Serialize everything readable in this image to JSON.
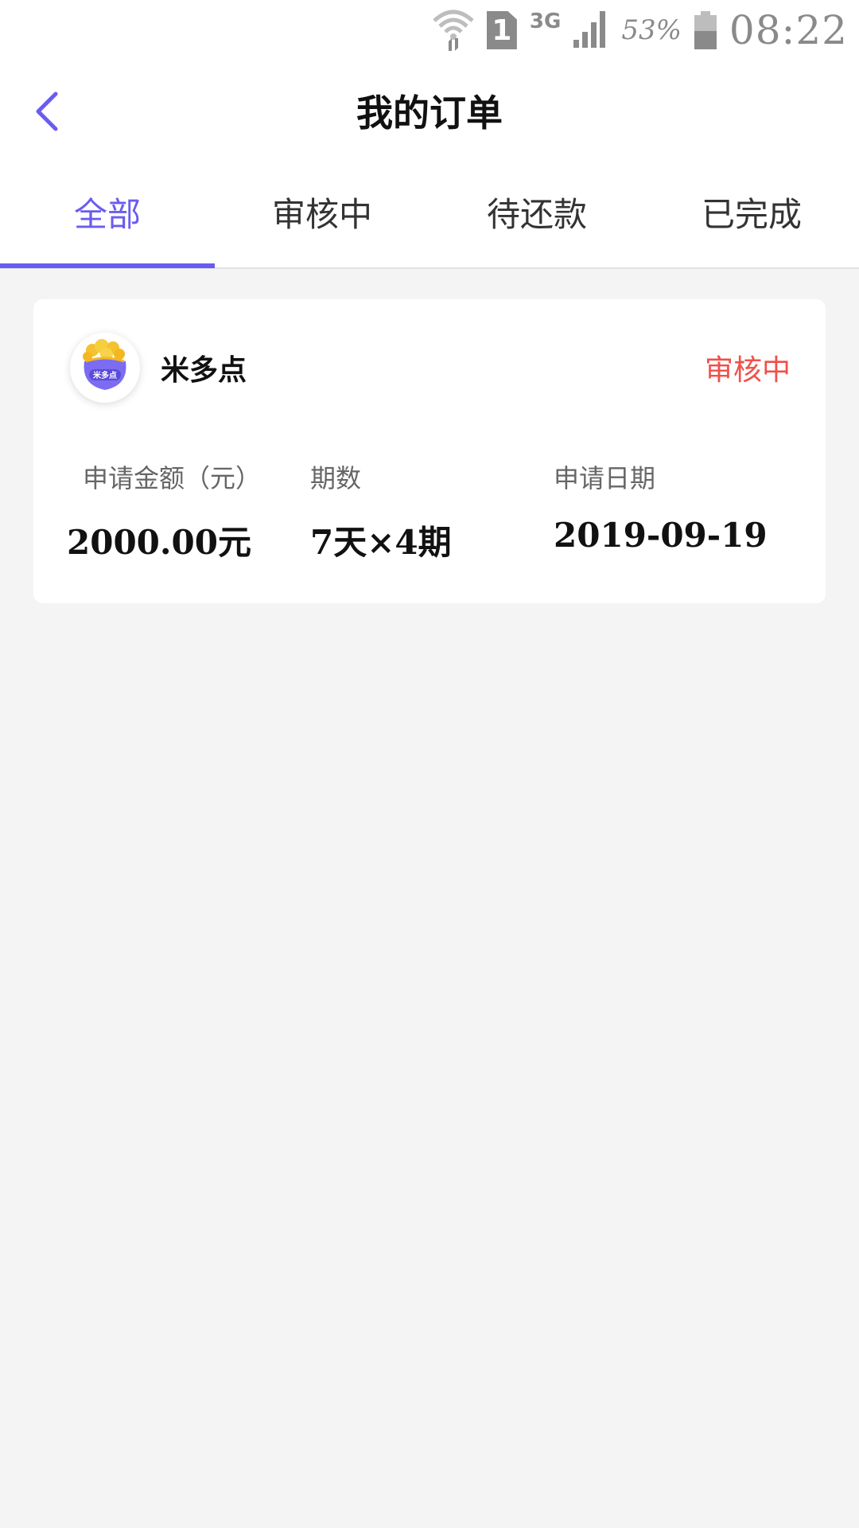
{
  "status_bar": {
    "icons": [
      "wifi-icon",
      "sim-icon",
      "signal-icon",
      "battery-icon"
    ],
    "sim_label": "1",
    "network": "3G",
    "battery_percent": "53%",
    "battery_level": 0.53,
    "time": "08:22"
  },
  "header": {
    "title": "我的订单",
    "back_icon": "chevron-left-icon"
  },
  "tabs": [
    {
      "label": "全部",
      "active": true
    },
    {
      "label": "审核中",
      "active": false
    },
    {
      "label": "待还款",
      "active": false
    },
    {
      "label": "已完成",
      "active": false
    }
  ],
  "order": {
    "merchant_name": "米多点",
    "logo_text": "米多点",
    "status": "审核中",
    "fields": [
      {
        "label": "申请金额（元）",
        "value": "2000.00元"
      },
      {
        "label": "期数",
        "value": "7天×4期"
      },
      {
        "label": "申请日期",
        "value": "2019-09-19"
      }
    ]
  },
  "colors": {
    "accent": "#6a5cf0",
    "status_red": "#f0504a",
    "background": "#f4f4f4"
  }
}
